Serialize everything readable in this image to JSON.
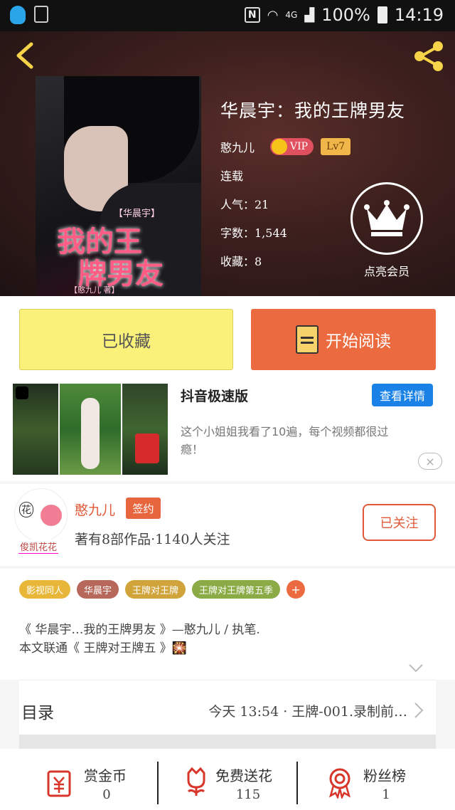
{
  "status_bar": {
    "battery": "100%",
    "time": "14:19",
    "network": "4G"
  },
  "book": {
    "title": "华晨宇：我的王牌男友",
    "author": "憨九儿",
    "vip_label": "VIP",
    "level": "Lv7",
    "status": "连载",
    "popularity": "人气：21",
    "word_count": "字数：1,544",
    "favorites": "收藏：8",
    "member_label": "点亮会员",
    "cover": {
      "small_title": "【华晨宇】",
      "title_line1": "我的王",
      "title_line2": "牌男友",
      "author": "【憨九儿 著】"
    }
  },
  "actions": {
    "favorited_label": "已收藏",
    "read_label": "开始阅读"
  },
  "ad": {
    "title": "抖音极速版",
    "detail_button": "查看详情",
    "description": "这个小姐姐我看了10遍，每个视频都很过瘾！",
    "close_icon": "×"
  },
  "author_card": {
    "avatar_text": "花",
    "avatar_tag": "俊凯花花",
    "name": "憨九儿",
    "sign_badge": "签约",
    "stats": "著有8部作品·1140人关注",
    "follow_label": "已关注"
  },
  "tags": [
    {
      "label": "影视同人",
      "color": "#e8b73a"
    },
    {
      "label": "华晨宇",
      "color": "#b7685b"
    },
    {
      "label": "王牌对王牌",
      "color": "#d0a43a"
    },
    {
      "label": "王牌对王牌第五季",
      "color": "#8aab46"
    },
    {
      "label": "+",
      "color": "#ec6a3f"
    }
  ],
  "description": {
    "line1": "《 华晨宇…我的王牌男友 》—憨九儿 / 执笔.",
    "line2": "本文联通《 王牌对王牌五 》🎇"
  },
  "catalog": {
    "label": "目录",
    "latest": "今天 13:54 · 王牌-001.录制前…"
  },
  "bottom_bar": [
    {
      "title": "赏金币",
      "count": "0",
      "icon": "reward-coin-icon"
    },
    {
      "title": "免费送花",
      "count": "115",
      "icon": "flower-icon"
    },
    {
      "title": "粉丝榜",
      "count": "1",
      "icon": "ribbon-icon"
    }
  ],
  "colors": {
    "accent": "#ec6a3f",
    "favorite_button": "#faf17a",
    "link_blue": "#1a82e6"
  }
}
